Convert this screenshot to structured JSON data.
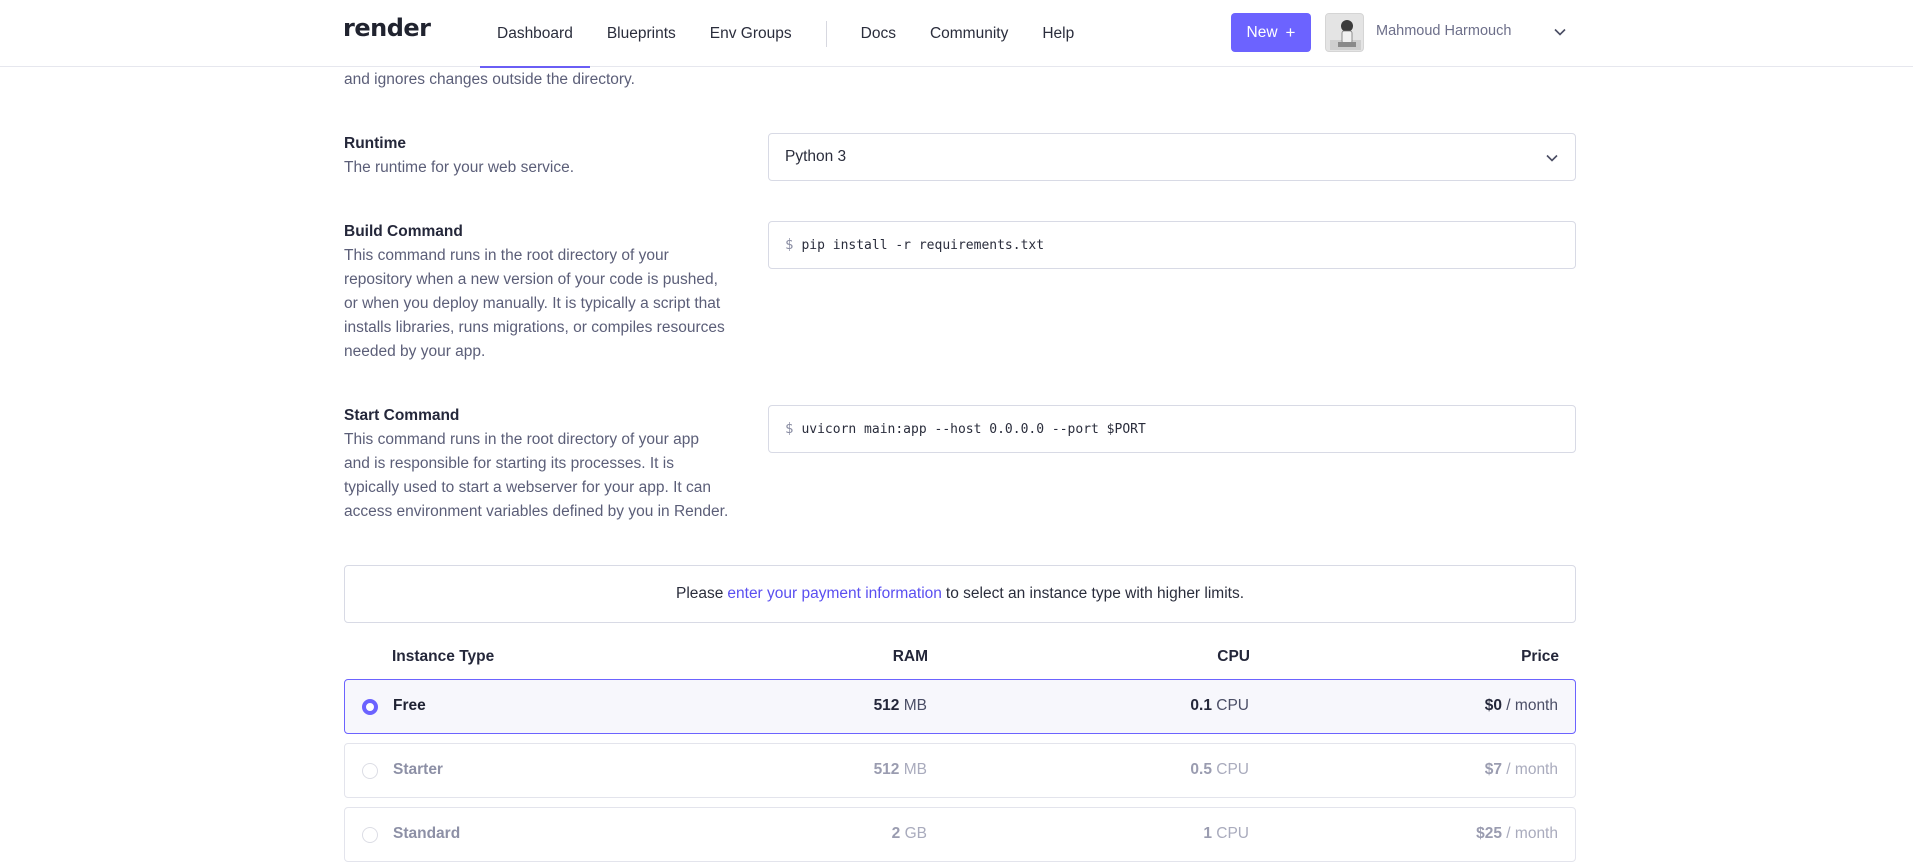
{
  "nav": {
    "logo": "render",
    "links": [
      "Dashboard",
      "Blueprints",
      "Env Groups"
    ],
    "links_secondary": [
      "Docs",
      "Community",
      "Help"
    ],
    "active": "Dashboard",
    "new_button": "New",
    "user_name": "Mahmoud Harmouch",
    "accent_color": "#6c63ff"
  },
  "root_dir_desc_fragment": "and ignores changes outside the directory.",
  "runtime": {
    "title": "Runtime",
    "description": "The runtime for your web service.",
    "value": "Python 3"
  },
  "build_command": {
    "title": "Build Command",
    "description": "This command runs in the root directory of your repository when a new version of your code is pushed, or when you deploy manually. It is typically a script that installs libraries, runs migrations, or compiles resources needed by your app.",
    "prompt": "$",
    "value": "pip install -r requirements.txt"
  },
  "start_command": {
    "title": "Start Command",
    "description": "This command runs in the root directory of your app and is responsible for starting its processes. It is typically used to start a webserver for your app. It can access environment variables defined by you in Render.",
    "prompt": "$",
    "value": "uvicorn main:app --host 0.0.0.0 --port $PORT"
  },
  "payment_notice": {
    "before": "Please",
    "link": "enter your payment information",
    "after": "to select an instance type with higher limits."
  },
  "instance_table": {
    "headers": {
      "type": "Instance Type",
      "ram": "RAM",
      "cpu": "CPU",
      "price": "Price"
    },
    "rows": [
      {
        "name": "Free",
        "ram_value": "512",
        "ram_unit": "MB",
        "cpu_value": "0.1",
        "cpu_unit": "CPU",
        "price_value": "$0",
        "price_unit": "/ month",
        "selected": true,
        "enabled": true
      },
      {
        "name": "Starter",
        "ram_value": "512",
        "ram_unit": "MB",
        "cpu_value": "0.5",
        "cpu_unit": "CPU",
        "price_value": "$7",
        "price_unit": "/ month",
        "selected": false,
        "enabled": false
      },
      {
        "name": "Standard",
        "ram_value": "2",
        "ram_unit": "GB",
        "cpu_value": "1",
        "cpu_unit": "CPU",
        "price_value": "$25",
        "price_unit": "/ month",
        "selected": false,
        "enabled": false
      }
    ]
  }
}
